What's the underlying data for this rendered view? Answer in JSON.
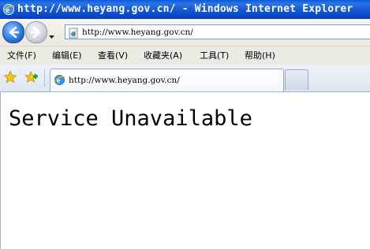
{
  "window": {
    "title": "http://www.heyang.gov.cn/ - Windows Internet Explorer",
    "icon": "ie-icon"
  },
  "address_bar": {
    "url": "http://www.heyang.gov.cn/"
  },
  "menu": {
    "items": [
      {
        "label": "文件(F)"
      },
      {
        "label": "编辑(E)"
      },
      {
        "label": "查看(V)"
      },
      {
        "label": "收藏夹(A)"
      },
      {
        "label": "工具(T)"
      },
      {
        "label": "帮助(H)"
      }
    ]
  },
  "tabs": [
    {
      "label": "http://www.heyang.gov.cn/",
      "active": true
    }
  ],
  "page": {
    "heading": "Service Unavailable"
  },
  "colors": {
    "titlebar": "#0a47c6",
    "chrome": "#ecebe3",
    "tab_border": "#97aacb"
  }
}
